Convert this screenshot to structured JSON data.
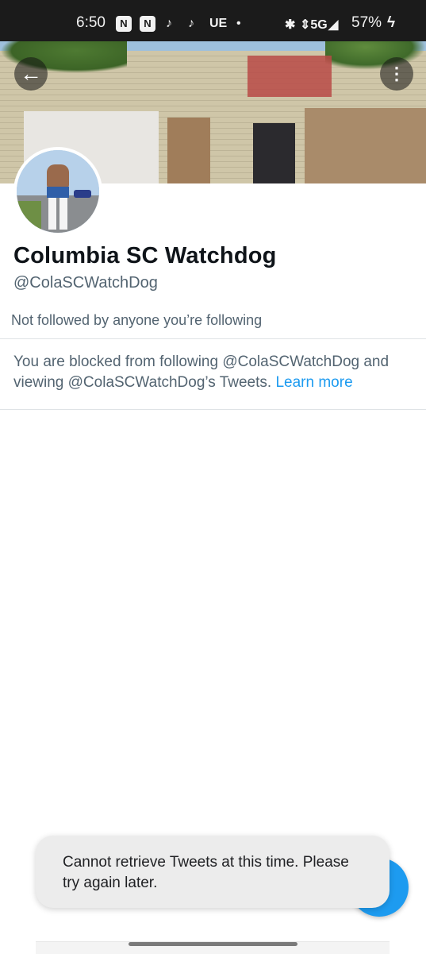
{
  "status_bar": {
    "time": "6:50",
    "app_icons": [
      "N",
      "N"
    ],
    "tiktok_glyphs": [
      "♪",
      "♪"
    ],
    "ue_label": "UE",
    "dot": "•",
    "bluetooth": "✱",
    "network": "⇕5G",
    "signal_glyph": "◢",
    "battery": "57%",
    "charging_glyph": "ϟ"
  },
  "header": {
    "back_glyph": "←",
    "more_glyph": "⋮"
  },
  "profile": {
    "display_name": "Columbia SC Watchdog",
    "handle": "@ColaSCWatchDog",
    "followed_status": "Not followed by anyone you’re following"
  },
  "blocked_notice": {
    "text": "You are blocked from following @ColaSCWatchDog and viewing @ColaSCWatchDog’s Tweets. ",
    "link": "Learn more"
  },
  "compose": {
    "glyph": "+"
  },
  "toast": {
    "message": "Cannot retrieve Tweets at this time. Please try again later."
  },
  "colors": {
    "accent": "#1d9bf0",
    "text_primary": "#0f1419",
    "text_secondary": "#536471"
  }
}
